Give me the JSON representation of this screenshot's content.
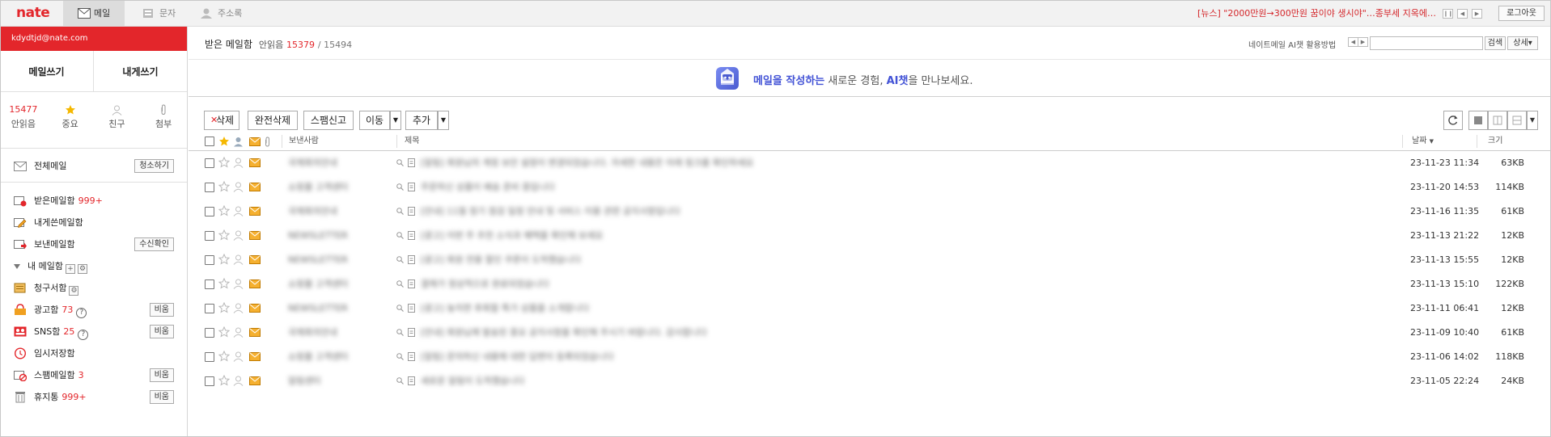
{
  "topbar": {
    "logo": "nate",
    "tabs": [
      {
        "label": "메일",
        "icon": "mail-icon",
        "active": true
      },
      {
        "label": "문자",
        "icon": "sms-icon",
        "active": false
      },
      {
        "label": "주소록",
        "icon": "contacts-icon",
        "active": false
      }
    ],
    "news": "[뉴스] \"2000만원→300만원 꿈이야 생시야\"…종부세 지옥에…",
    "logout": "로그아웃"
  },
  "sidebar": {
    "account": "kdydtjd@nate.com",
    "compose": "메일쓰기",
    "self_compose": "내게쓰기",
    "stats": [
      {
        "value": "15477",
        "label": "안읽음",
        "icon": "unread-count"
      },
      {
        "value": "",
        "label": "중요",
        "icon": "star-icon"
      },
      {
        "value": "",
        "label": "친구",
        "icon": "person-icon"
      },
      {
        "value": "",
        "label": "첨부",
        "icon": "paperclip-icon"
      }
    ],
    "all_mail": {
      "label": "전체메일",
      "button": "청소하기"
    },
    "folders": [
      {
        "label": "받은메일함",
        "count": "999+",
        "icon": "inbox-icon"
      },
      {
        "label": "내게쓴메일함",
        "count": "",
        "icon": "pencil-icon"
      },
      {
        "label": "보낸메일함",
        "count": "",
        "icon": "sent-icon",
        "button": "수신확인"
      },
      {
        "label": "내 메일함",
        "count": "",
        "icon": "folder-toggle"
      },
      {
        "label": "청구서함",
        "count": "",
        "icon": "bill-icon"
      },
      {
        "label": "광고함",
        "count": "73",
        "icon": "ad-icon",
        "button": "비움"
      },
      {
        "label": "SNS함",
        "count": "25",
        "icon": "sns-icon",
        "button": "비움"
      },
      {
        "label": "임시저장함",
        "count": "",
        "icon": "draft-icon"
      },
      {
        "label": "스팸메일함",
        "count": "3",
        "icon": "spam-icon",
        "button": "비움"
      },
      {
        "label": "휴지통",
        "count": "999+",
        "icon": "trash-icon",
        "button": "비움"
      }
    ]
  },
  "main": {
    "title": "받은 메일함",
    "unread_label": "안읽음",
    "unread": "15379",
    "total": "/ 15494",
    "ai_help": "네이트메일 AI챗 활용방법",
    "search": {
      "placeholder": "",
      "button": "검색",
      "detail": "상세"
    },
    "banner": {
      "part1": "메일을 작성하는",
      "part2": " 새로운 경험, ",
      "part3": "AI챗",
      "part4": "을 만나보세요."
    },
    "toolbar": {
      "delete": "삭제",
      "perm_delete": "완전삭제",
      "spam": "스팸신고",
      "move": "이동",
      "add": "추가"
    },
    "columns": {
      "sender": "보낸사람",
      "subject": "제목",
      "date": "날짜",
      "size": "크기"
    },
    "rows": [
      {
        "sender": "국제회의안내",
        "subject": "[알림] 회원님의 계정 보안 설정이 변경되었습니다. 자세한 내용은 아래 링크를 확인하세요",
        "date": "23-11-23 11:34",
        "size": "63KB"
      },
      {
        "sender": "쇼핑몰 고객센터",
        "subject": "주문하신 상품이 배송 준비 중입니다",
        "date": "23-11-20 14:53",
        "size": "114KB"
      },
      {
        "sender": "국제회의안내",
        "subject": "[안내] 11월 정기 점검 일정 안내 및 서비스 이용 관련 공지사항입니다",
        "date": "23-11-16 11:35",
        "size": "61KB"
      },
      {
        "sender": "NEWSLETTER",
        "subject": "[광고] 이번 주 추천 소식과 혜택을 확인해 보세요",
        "date": "23-11-13 21:22",
        "size": "12KB"
      },
      {
        "sender": "NEWSLETTER",
        "subject": "[광고] 회원 전용 할인 쿠폰이 도착했습니다",
        "date": "23-11-13 15:55",
        "size": "12KB"
      },
      {
        "sender": "쇼핑몰 고객센터",
        "subject": "결제가 정상적으로 완료되었습니다",
        "date": "23-11-13 15:10",
        "size": "122KB"
      },
      {
        "sender": "NEWSLETTER",
        "subject": "[광고] 놓치면 후회할 특가 상품을 소개합니다",
        "date": "23-11-11 06:41",
        "size": "12KB"
      },
      {
        "sender": "국제회의안내",
        "subject": "[안내] 회원님께 발송된 중요 공지사항을 확인해 주시기 바랍니다. 감사합니다",
        "date": "23-11-09 10:40",
        "size": "61KB"
      },
      {
        "sender": "쇼핑몰 고객센터",
        "subject": "[알림] 문의하신 내용에 대한 답변이 등록되었습니다",
        "date": "23-11-06 14:02",
        "size": "118KB"
      },
      {
        "sender": "알림센터",
        "subject": "새로운 알림이 도착했습니다",
        "date": "23-11-05 22:24",
        "size": "24KB"
      }
    ]
  },
  "colors": {
    "brand": "#e3262b",
    "banner": "#4353d6",
    "envelope": "#f0a020"
  }
}
